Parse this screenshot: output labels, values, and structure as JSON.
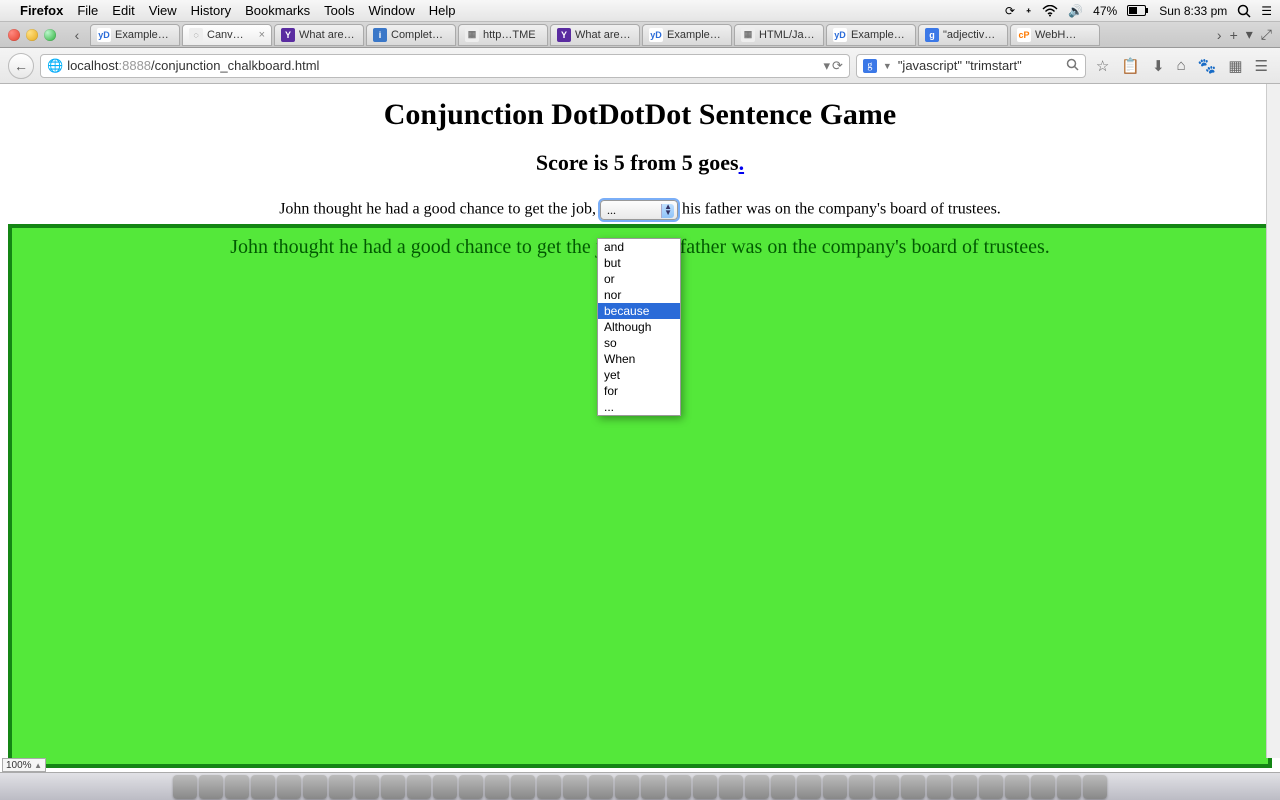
{
  "menubar": {
    "app": "Firefox",
    "items": [
      "File",
      "Edit",
      "View",
      "History",
      "Bookmarks",
      "Tools",
      "Window",
      "Help"
    ],
    "battery": "47%",
    "clock": "Sun 8:33 pm"
  },
  "tabs": {
    "list": [
      {
        "label": "Example…",
        "fav": "yD",
        "favbg": "#ffffff",
        "favcolor": "#2a6bd8"
      },
      {
        "label": "Canv…",
        "fav": "◌",
        "favbg": "#eeeeee",
        "favcolor": "#555555",
        "active": true
      },
      {
        "label": "What are…",
        "fav": "Y",
        "favbg": "#5a2ca0",
        "favcolor": "#ffffff"
      },
      {
        "label": "Complet…",
        "fav": "i",
        "favbg": "#3a77c8",
        "favcolor": "#ffffff"
      },
      {
        "label": "http…TME",
        "fav": "▦",
        "favbg": "#eeeeee",
        "favcolor": "#777777"
      },
      {
        "label": "What are…",
        "fav": "Y",
        "favbg": "#5a2ca0",
        "favcolor": "#ffffff"
      },
      {
        "label": "Example…",
        "fav": "yD",
        "favbg": "#ffffff",
        "favcolor": "#2a6bd8"
      },
      {
        "label": "HTML/Ja…",
        "fav": "▦",
        "favbg": "#eeeeee",
        "favcolor": "#777777"
      },
      {
        "label": "Example…",
        "fav": "yD",
        "favbg": "#ffffff",
        "favcolor": "#2a6bd8"
      },
      {
        "label": "\"adjectiv…",
        "fav": "g",
        "favbg": "#3b78e7",
        "favcolor": "#ffffff"
      },
      {
        "label": "WebH…",
        "fav": "cP",
        "favbg": "#ffffff",
        "favcolor": "#ff7a00"
      }
    ]
  },
  "url": {
    "host": "localhost",
    "port": ":8888",
    "path": "/conjunction_chalkboard.html"
  },
  "search": {
    "query": "\"javascript\" \"trimstart\""
  },
  "page": {
    "title": "Conjunction DotDotDot Sentence Game",
    "score_prefix": "Score is ",
    "score_mid": "5 from 5 goes",
    "score_dot": ".",
    "sentence_left": "John thought he had a good chance to get the job, ",
    "sentence_right": " his father was on the company's board of trustees.",
    "select_value": "...",
    "board_sentence": "John thought he had a good chance to get the job, ... his father was on the company's board of trustees."
  },
  "dropdown": {
    "options": [
      "and",
      "but",
      "or",
      "nor",
      "because",
      "Although",
      "so",
      "When",
      "yet",
      "for",
      "..."
    ],
    "highlighted": "because"
  },
  "zoom": "100%"
}
